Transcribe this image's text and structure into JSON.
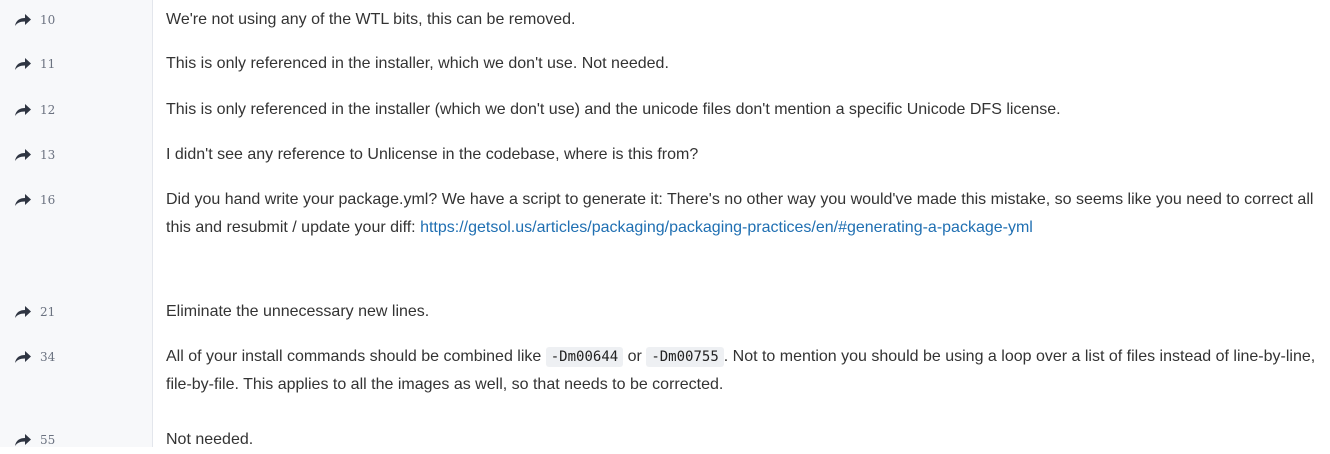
{
  "comments": [
    {
      "line": "10",
      "text": "We're not using any of the WTL bits, this can be removed."
    },
    {
      "line": "11",
      "text": "This is only referenced in the installer, which we don't use. Not needed."
    },
    {
      "line": "12",
      "text": "This is only referenced in the installer (which we don't use) and the unicode files don't mention a specific Unicode DFS license."
    },
    {
      "line": "13",
      "text": "I didn't see any reference to Unlicense in the codebase, where is this from?"
    },
    {
      "line": "16",
      "text": "Did you hand write your package.yml? We have a script to generate it: There's no other way you would've made this mistake, so seems like you need to correct all this and resubmit / update your diff: ",
      "link": "https://getsol.us/articles/packaging/packaging-practices/en/#generating-a-package-yml"
    },
    {
      "line": "21",
      "text": "Eliminate the unnecessary new lines."
    },
    {
      "line": "34",
      "text_before": "All of your install commands should be combined like ",
      "code1": "-Dm00644",
      "text_mid": " or ",
      "code2": "-Dm00755",
      "text_after": ". Not to mention you should be using a loop over a list of files instead of line-by-line, file-by-file. This applies to all the images as well, so that needs to be corrected."
    },
    {
      "line": "55",
      "text": "Not needed."
    }
  ],
  "icons": {
    "jump": "share-arrow-icon"
  },
  "colors": {
    "link": "#1f6fb2",
    "gutter": "#f7f8fa",
    "text": "#333333"
  }
}
